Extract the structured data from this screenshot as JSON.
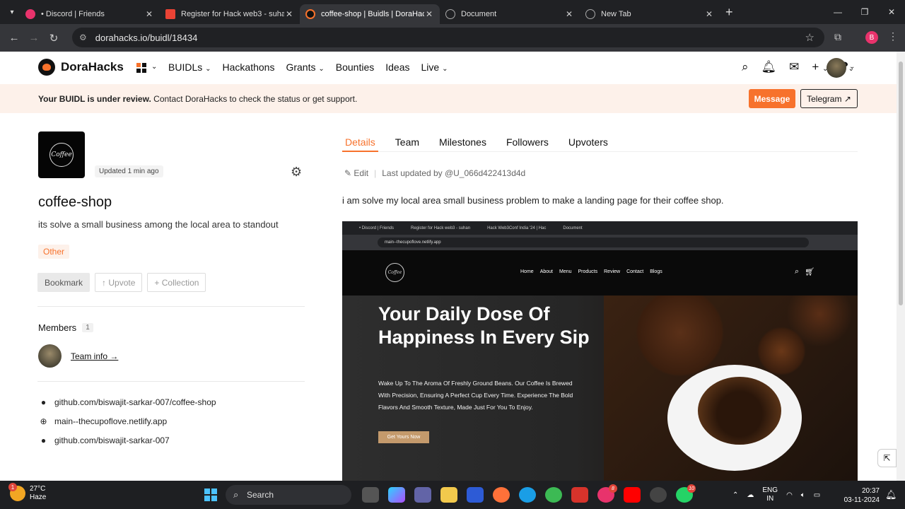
{
  "browser": {
    "tabs": [
      {
        "title": "• Discord | Friends",
        "color": "#e8336c"
      },
      {
        "title": "Register for Hack web3 - suhan",
        "color": "#ea4335"
      },
      {
        "title": "coffee-shop | Buidls | DoraHack",
        "color": "#111111"
      },
      {
        "title": "Document",
        "color": "#888888"
      },
      {
        "title": "New Tab",
        "color": "#888888"
      }
    ],
    "address": "dorahacks.io/buidl/18434",
    "profile_initial": "B"
  },
  "header": {
    "logo": "DoraHacks",
    "nav": [
      "BUIDLs",
      "Hackathons",
      "Grants",
      "Bounties",
      "Ideas",
      "Live"
    ],
    "nav_dropdown": [
      true,
      false,
      true,
      false,
      false,
      true
    ]
  },
  "banner": {
    "bold": "Your BUIDL is under review.",
    "text": "Contact DoraHacks to check the status or get support.",
    "message_btn": "Message",
    "telegram_btn": "Telegram ↗"
  },
  "project": {
    "logo_text": "Coffee",
    "updated": "Updated 1 min ago",
    "title": "coffee-shop",
    "subtitle": "its solve a small business among the local area to standout",
    "tag": "Other",
    "actions": {
      "bookmark": "Bookmark",
      "upvote": "↑ Upvote",
      "collection": "+ Collection"
    },
    "members_label": "Members",
    "members_count": "1",
    "team_info": "Team info →",
    "links": [
      {
        "icon": "github-icon",
        "text": "github.com/biswajit-sarkar-007/coffee-shop"
      },
      {
        "icon": "globe-icon",
        "text": "main--thecupoflove.netlify.app"
      },
      {
        "icon": "github-icon",
        "text": "github.com/biswajit-sarkar-007"
      }
    ]
  },
  "detail": {
    "tabs": [
      "Details",
      "Team",
      "Milestones",
      "Followers",
      "Upvoters"
    ],
    "active_tab": "Details",
    "edit": "Edit",
    "last_updated": "Last updated by @U_066d422413d4d",
    "description": "i am solve my local area small business problem to make a landing page for their coffee shop."
  },
  "screenshot": {
    "tabs": [
      "• Discord | Friends",
      "Register for Hack web3 - suhan",
      "Hack Web3Conf India '24 | Hac",
      "Document"
    ],
    "url": "main--thecupoflove.netlify.app",
    "menu": [
      "Home",
      "About",
      "Menu",
      "Products",
      "Review",
      "Contact",
      "Blogs"
    ],
    "logo_text": "Coffee",
    "headline": "Your Daily Dose Of Happiness In Every Sip",
    "body": "Wake Up To The Aroma Of Freshly Ground Beans. Our Coffee Is Brewed With Precision, Ensuring A Perfect Cup Every Time. Experience The Bold Flavors And Smooth Texture, Made Just For You To Enjoy.",
    "cta": "Get Yours Now"
  },
  "taskbar": {
    "temp": "27°C",
    "weather": "Haze",
    "weather_badge": "1",
    "search": "Search",
    "chrome_badge": "8",
    "whatsapp_badge": "10",
    "lang1": "ENG",
    "lang2": "IN",
    "time": "20:37",
    "date": "03-11-2024"
  },
  "colors": {
    "accent": "#f7722c",
    "banner_bg": "#fdf1ea"
  }
}
